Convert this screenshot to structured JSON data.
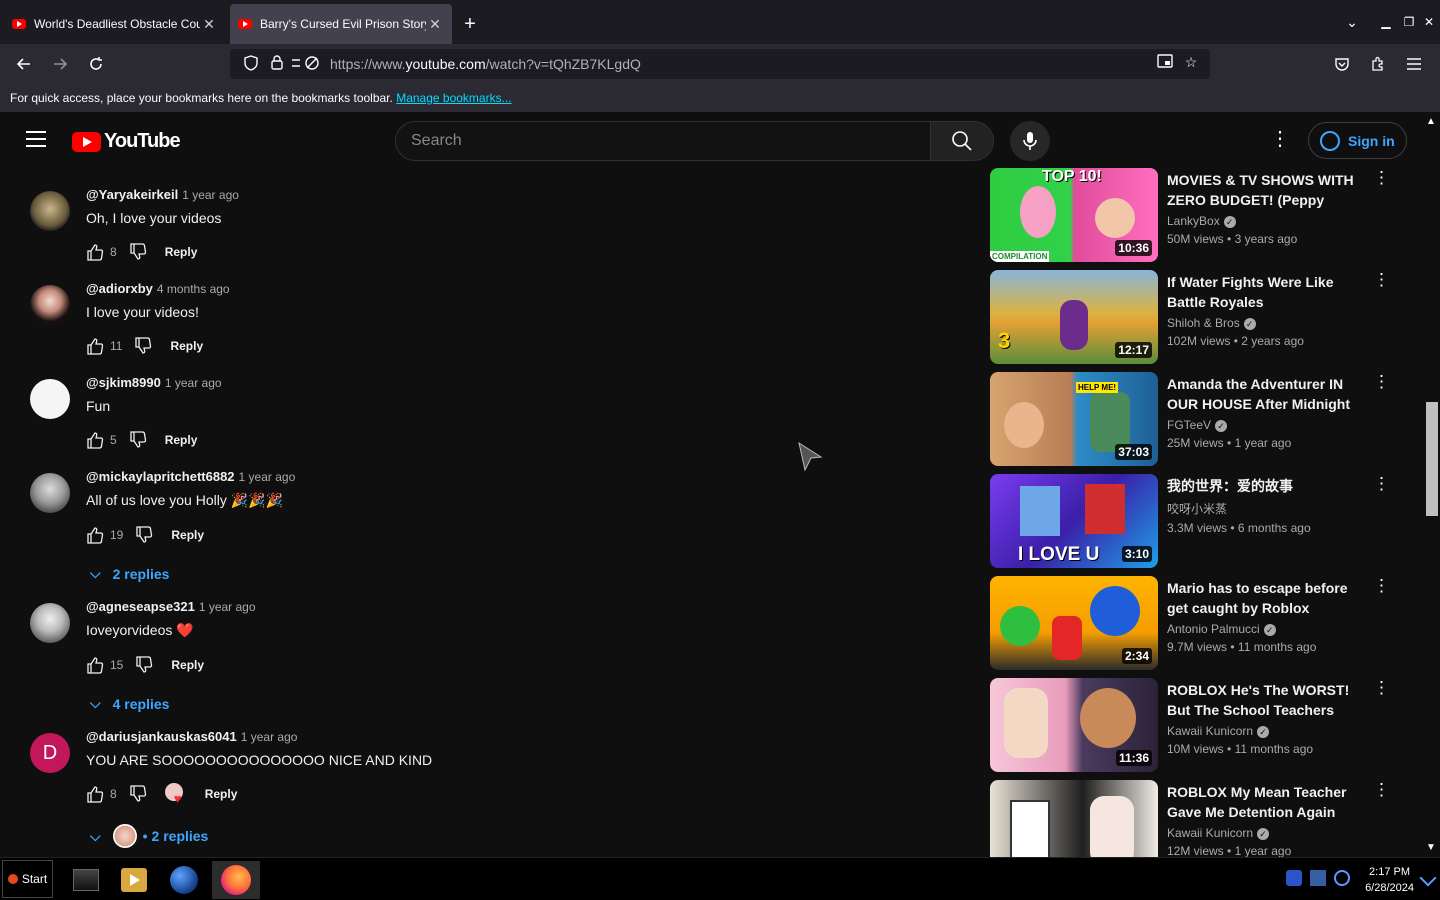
{
  "browser": {
    "tabs": [
      {
        "title": "World's Deadliest Obstacle Cou",
        "active": false
      },
      {
        "title": "Barry's Cursed Evil Prison Story",
        "active": true
      }
    ],
    "url_prefix": "https://www.",
    "url_host": "youtube.com",
    "url_path": "/watch?v=tQhZB7KLgdQ",
    "bookmarks_text": "For quick access, place your bookmarks here on the bookmarks toolbar.",
    "bookmarks_link": "Manage bookmarks..."
  },
  "youtube": {
    "logo_text": "YouTube",
    "search_placeholder": "Search",
    "signin_label": "Sign in",
    "comments": [
      {
        "author": "@Yaryakeirkeil",
        "time": "1 year ago",
        "text": "Oh, I love your videos",
        "likes": "8",
        "reply": "Reply",
        "replies": ""
      },
      {
        "author": "@adiorxby",
        "time": "4 months ago",
        "text": "I love your videos!",
        "likes": "11",
        "reply": "Reply",
        "replies": ""
      },
      {
        "author": "@sjkim8990",
        "time": "1 year ago",
        "text": "Fun",
        "likes": "5",
        "reply": "Reply",
        "replies": ""
      },
      {
        "author": "@mickaylapritchett6882",
        "time": "1 year ago",
        "text": "All of us love you Holly 🎉🎉🎉",
        "likes": "19",
        "reply": "Reply",
        "replies": "2 replies"
      },
      {
        "author": "@agneseapse321",
        "time": "1 year ago",
        "text": "Ioveyorvideos ❤️",
        "likes": "15",
        "reply": "Reply",
        "replies": "4 replies"
      },
      {
        "author": "@dariusjankauskas6041",
        "time": "1 year ago",
        "text": "YOU ARE SOOOOOOOOOOOOOOO NICE AND KIND",
        "likes": "8",
        "reply": "Reply",
        "replies": "2 replies",
        "avatar_letter": "D"
      }
    ],
    "recommended": [
      {
        "title": "MOVIES & TV SHOWS WITH ZERO BUDGET! (Peppy Piggy,...",
        "channel": "LankyBox",
        "verified": true,
        "views": "50M views",
        "age": "3 years ago",
        "duration": "10:36",
        "thumb_text": "TOP 10!",
        "thumb_badge": "COMPILATION"
      },
      {
        "title": "If Water Fights Were Like Battle Royales",
        "channel": "Shiloh & Bros",
        "verified": true,
        "views": "102M views",
        "age": "2 years ago",
        "duration": "12:17"
      },
      {
        "title": "Amanda the Adventurer IN OUR HOUSE After Midnight (ON A...",
        "channel": "FGTeeV",
        "verified": true,
        "views": "25M views",
        "age": "1 year ago",
        "duration": "37:03",
        "thumb_badge": "HELP ME!"
      },
      {
        "title": "我的世界：爱的故事",
        "channel": "咬呀小米蒸",
        "verified": false,
        "views": "3.3M views",
        "age": "6 months ago",
        "duration": "3:10",
        "thumb_text": "I LOVE U"
      },
      {
        "title": "Mario has to escape before get caught by Roblox Rainbow...",
        "channel": "Antonio Palmucci",
        "verified": true,
        "views": "9.7M views",
        "age": "11 months ago",
        "duration": "2:34"
      },
      {
        "title": "ROBLOX He's The WORST! But The School Teachers Love Him",
        "channel": "Kawaii Kunicorn",
        "verified": true,
        "views": "10M views",
        "age": "11 months ago",
        "duration": "11:36"
      },
      {
        "title": "ROBLOX My Mean Teacher Gave Me Detention Again",
        "channel": "Kawaii Kunicorn",
        "verified": true,
        "views": "12M views",
        "age": "1 year ago",
        "duration": ""
      }
    ]
  },
  "taskbar": {
    "start_label": "Start",
    "time": "2:17 PM",
    "date": "6/28/2024"
  },
  "colors": {
    "yt_red": "#ff0000",
    "link_blue": "#3ea6ff",
    "background": "#0f0f0f"
  }
}
